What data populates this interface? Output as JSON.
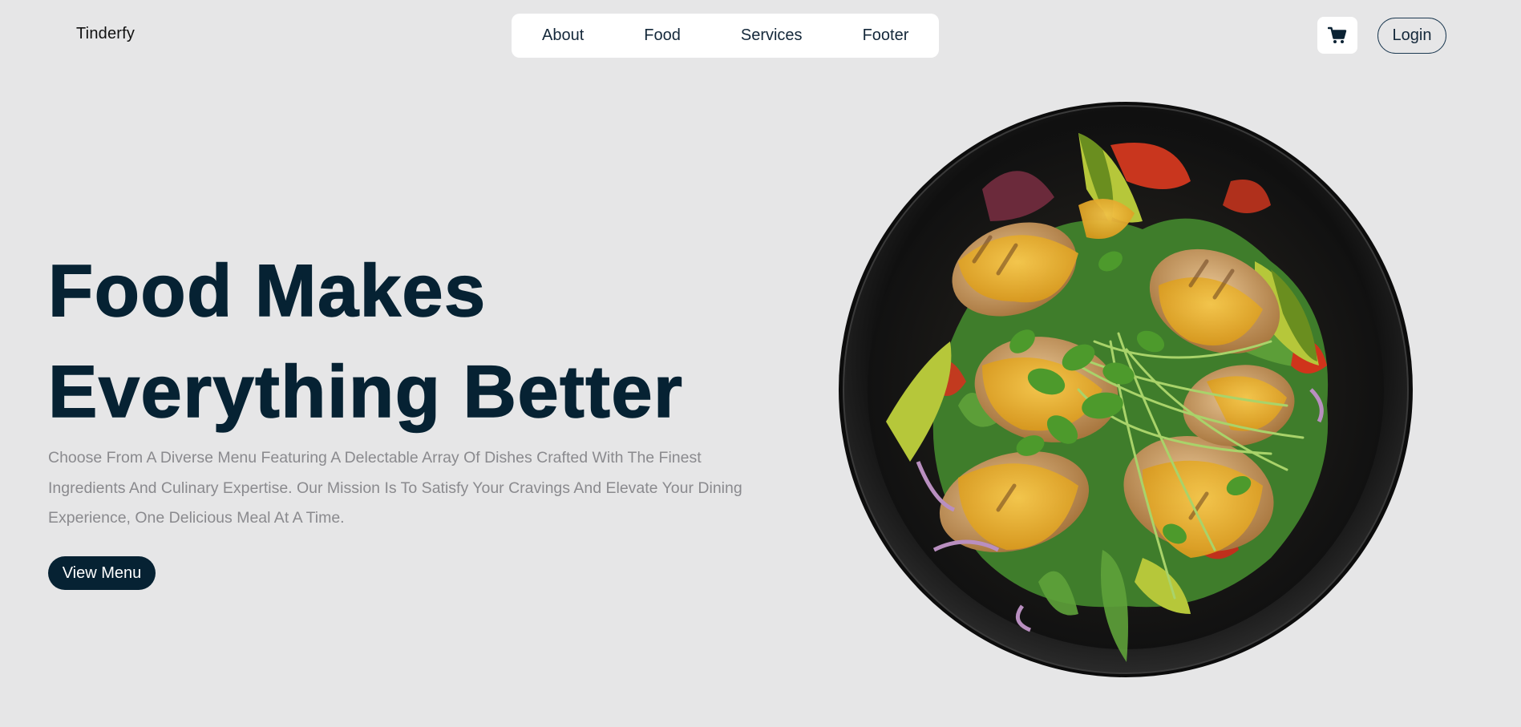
{
  "brand": {
    "name": "Tinderfy"
  },
  "nav": {
    "items": [
      {
        "label": "About"
      },
      {
        "label": "Food"
      },
      {
        "label": "Services"
      },
      {
        "label": "Footer"
      }
    ]
  },
  "header": {
    "cart_icon": "cart-icon",
    "login_label": "Login"
  },
  "hero": {
    "headline_line1": "Food Makes",
    "headline_line2": "Everything Better",
    "description": "Choose From A Diverse Menu Featuring A Delectable Array Of Dishes Crafted With The Finest Ingredients And Culinary Expertise. Our Mission Is To Satisfy Your Cravings And Elevate Your Dining Experience, One Delicious Meal At A Time.",
    "cta_label": "View Menu",
    "image": "salad-bowl-image"
  },
  "colors": {
    "background": "#e6e6e7",
    "primary": "#062233",
    "muted_text": "#8a8a8e",
    "surface": "#ffffff"
  }
}
